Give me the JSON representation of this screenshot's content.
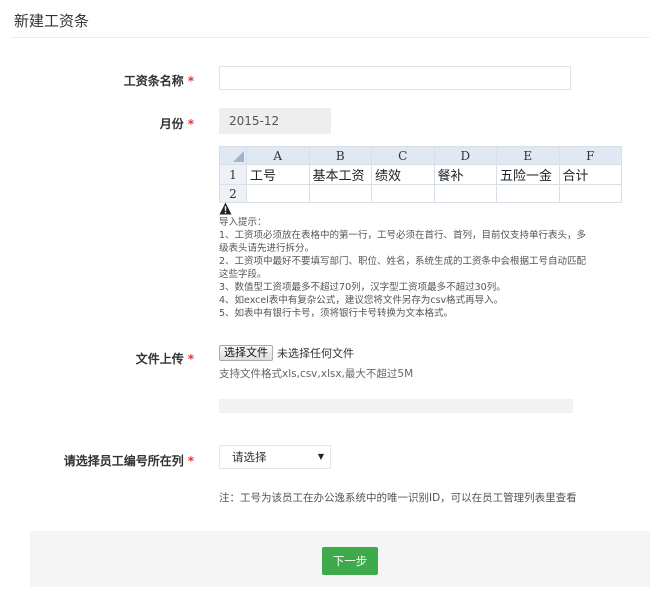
{
  "page": {
    "title": "新建工资条"
  },
  "form": {
    "name_label": "工资条名称",
    "name_required": "*",
    "name_value": "",
    "month_label": "月份",
    "month_required": "*",
    "month_value": "2015-12",
    "upload_label": "文件上传",
    "upload_required": "*",
    "employee_column_label": "请选择员工编号所在列",
    "employee_column_required": "*"
  },
  "excel_sample": {
    "columns": [
      "A",
      "B",
      "C",
      "D",
      "E",
      "F"
    ],
    "rows": [
      "1",
      "2"
    ],
    "headers": [
      "工号",
      "基本工资",
      "绩效",
      "餐补",
      "五险一金",
      "合计"
    ]
  },
  "tips": {
    "title": "导入提示：",
    "items": [
      "1、工资项必须放在表格中的第一行，工号必须在首行、首列，目前仅支持单行表头，多级表头请先进行拆分。",
      "2、工资项中最好不要填写部门、职位、姓名，系统生成的工资条中会根据工号自动匹配这些字段。",
      "3、数值型工资项最多不超过70列，汉字型工资项最多不超过30列。",
      "4、如excel表中有复杂公式，建议您将文件另存为csv格式再导入。",
      "5、如表中有银行卡号，须将银行卡号转换为文本格式。"
    ]
  },
  "upload": {
    "button_label": "选择文件",
    "status": "未选择任何文件",
    "hint": "支持文件格式xls,csv,xlsx,最大不超过5M",
    "progress": 0
  },
  "select": {
    "value": "请选择"
  },
  "note": "注：工号为该员工在办公逸系统中的唯一识别ID，可以在员工管理列表里查看",
  "actions": {
    "next_label": "下一步"
  },
  "colors": {
    "accent": "#3faa4c",
    "required": "#e63333"
  }
}
